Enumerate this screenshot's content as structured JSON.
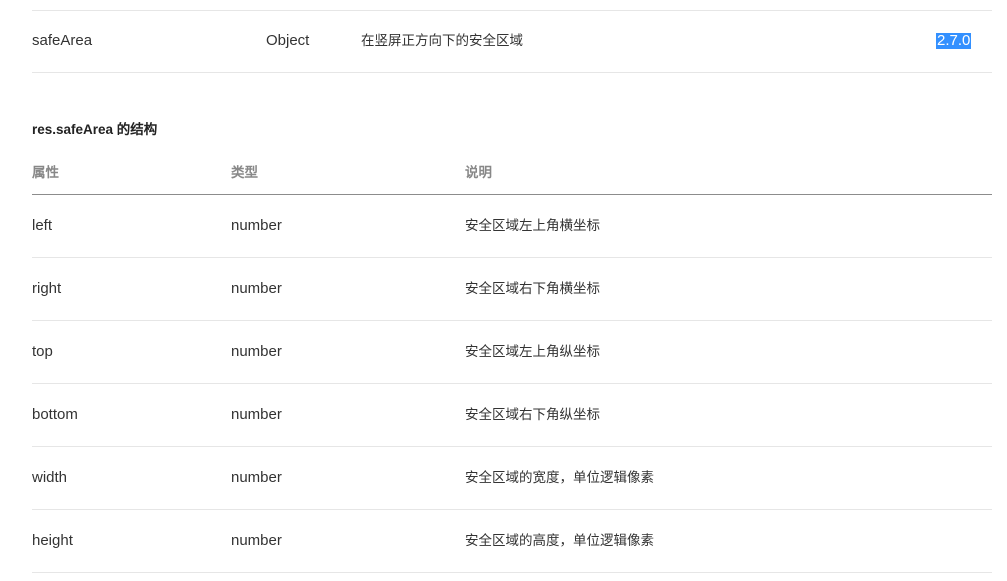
{
  "top_row": {
    "name": "safeArea",
    "type": "Object",
    "description": "在竖屏正方向下的安全区域",
    "version": "2.7.0"
  },
  "section_title": "res.safeArea 的结构",
  "table": {
    "headers": [
      "属性",
      "类型",
      "说明"
    ],
    "rows": [
      {
        "name": "left",
        "type": "number",
        "description": "安全区域左上角横坐标"
      },
      {
        "name": "right",
        "type": "number",
        "description": "安全区域右下角横坐标"
      },
      {
        "name": "top",
        "type": "number",
        "description": "安全区域左上角纵坐标"
      },
      {
        "name": "bottom",
        "type": "number",
        "description": "安全区域右下角纵坐标"
      },
      {
        "name": "width",
        "type": "number",
        "description": "安全区域的宽度，单位逻辑像素"
      },
      {
        "name": "height",
        "type": "number",
        "description": "安全区域的高度，单位逻辑像素"
      }
    ]
  },
  "colors": {
    "selection_highlight": "#3390ff",
    "header_text": "#888888",
    "body_text": "#333333",
    "row_divider": "#e6e6e6",
    "header_divider": "#8c8c8c"
  }
}
